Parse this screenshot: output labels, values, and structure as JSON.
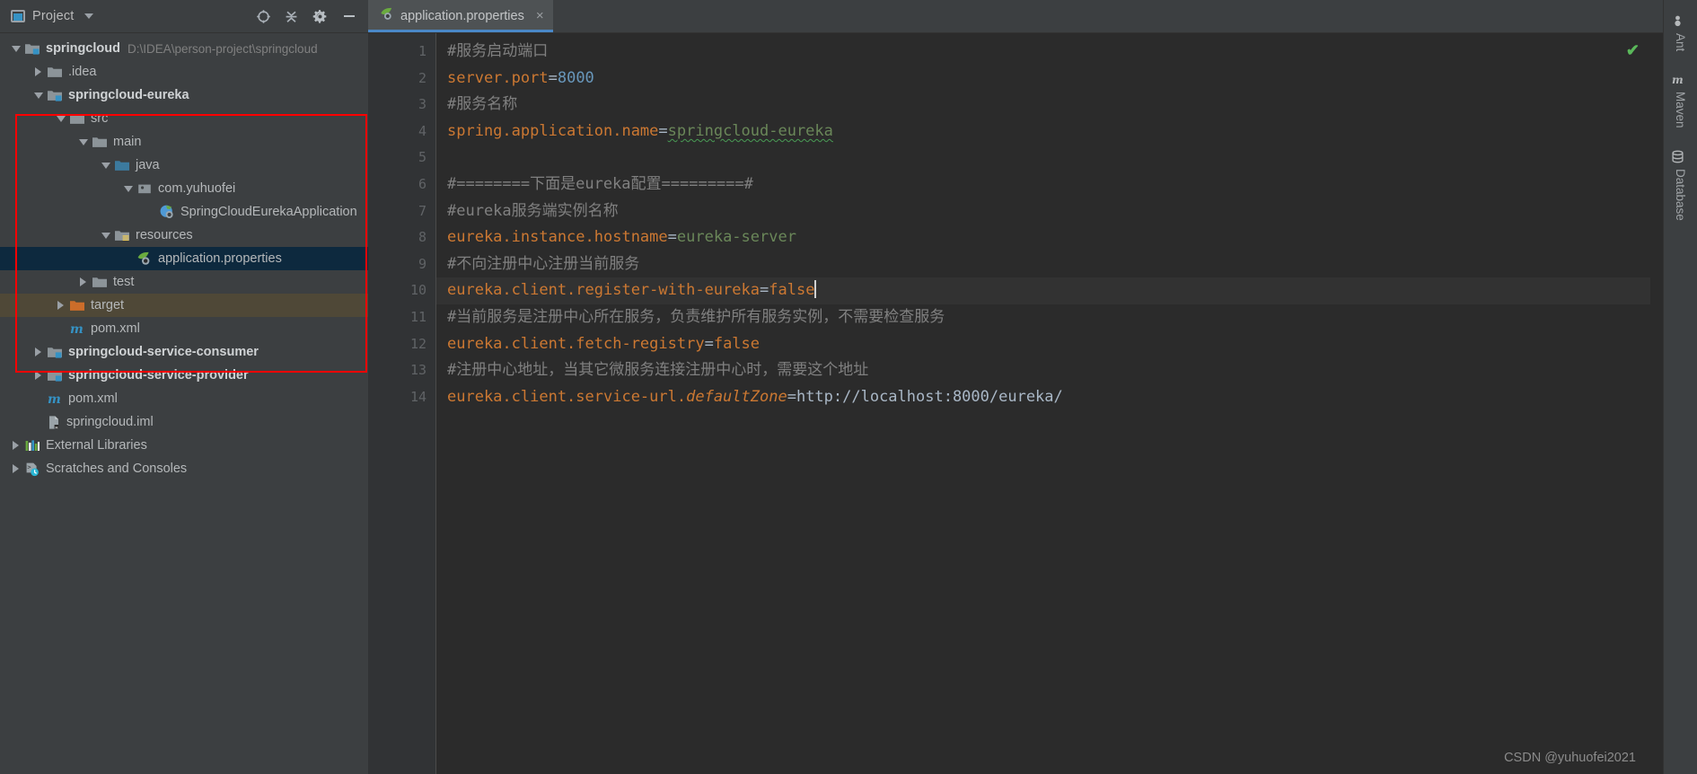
{
  "project_panel": {
    "title": "Project",
    "title_icon": "project-window-icon",
    "actions": [
      {
        "name": "locate-in-tree-icon",
        "glyph": "target-crosshair"
      },
      {
        "name": "collapse-all-icon",
        "glyph": "collapse-arrows"
      },
      {
        "name": "settings-gear-icon",
        "glyph": "gear"
      },
      {
        "name": "hide-panel-icon",
        "glyph": "minus"
      }
    ],
    "tree": [
      {
        "label": "springcloud",
        "path_hint": "D:\\IDEA\\person-project\\springcloud",
        "icon": "module-folder-icon",
        "indent": 0,
        "twisty": "open",
        "bold": true,
        "state": "normal"
      },
      {
        "label": ".idea",
        "path_hint": "",
        "icon": "folder-icon",
        "indent": 1,
        "twisty": "closed",
        "bold": false,
        "state": "normal"
      },
      {
        "label": "springcloud-eureka",
        "path_hint": "",
        "icon": "module-folder-icon",
        "indent": 1,
        "twisty": "open",
        "bold": true,
        "state": "normal"
      },
      {
        "label": "src",
        "path_hint": "",
        "icon": "folder-icon",
        "indent": 2,
        "twisty": "open",
        "bold": false,
        "state": "normal"
      },
      {
        "label": "main",
        "path_hint": "",
        "icon": "folder-icon",
        "indent": 3,
        "twisty": "open",
        "bold": false,
        "state": "normal"
      },
      {
        "label": "java",
        "path_hint": "",
        "icon": "source-root-folder-icon",
        "indent": 4,
        "twisty": "open",
        "bold": false,
        "state": "normal"
      },
      {
        "label": "com.yuhuofei",
        "path_hint": "",
        "icon": "package-icon",
        "indent": 5,
        "twisty": "open",
        "bold": false,
        "state": "normal"
      },
      {
        "label": "SpringCloudEurekaApplication",
        "path_hint": "",
        "icon": "spring-boot-class-icon",
        "indent": 6,
        "twisty": "none",
        "bold": false,
        "state": "normal"
      },
      {
        "label": "resources",
        "path_hint": "",
        "icon": "resources-root-folder-icon",
        "indent": 4,
        "twisty": "open",
        "bold": false,
        "state": "normal"
      },
      {
        "label": "application.properties",
        "path_hint": "",
        "icon": "spring-properties-icon",
        "indent": 5,
        "twisty": "none",
        "bold": false,
        "state": "selected"
      },
      {
        "label": "test",
        "path_hint": "",
        "icon": "folder-icon",
        "indent": 3,
        "twisty": "closed",
        "bold": false,
        "state": "normal"
      },
      {
        "label": "target",
        "path_hint": "",
        "icon": "excluded-folder-icon",
        "indent": 2,
        "twisty": "closed",
        "bold": false,
        "state": "excluded"
      },
      {
        "label": "pom.xml",
        "path_hint": "",
        "icon": "maven-pom-icon",
        "indent": 2,
        "twisty": "none",
        "bold": false,
        "state": "normal"
      },
      {
        "label": "springcloud-service-consumer",
        "path_hint": "",
        "icon": "module-folder-icon",
        "indent": 1,
        "twisty": "closed",
        "bold": true,
        "state": "normal"
      },
      {
        "label": "springcloud-service-provider",
        "path_hint": "",
        "icon": "module-folder-icon",
        "indent": 1,
        "twisty": "closed",
        "bold": true,
        "state": "normal"
      },
      {
        "label": "pom.xml",
        "path_hint": "",
        "icon": "maven-pom-icon",
        "indent": 1,
        "twisty": "none",
        "bold": false,
        "state": "normal"
      },
      {
        "label": "springcloud.iml",
        "path_hint": "",
        "icon": "iml-module-file-icon",
        "indent": 1,
        "twisty": "none",
        "bold": false,
        "state": "normal"
      },
      {
        "label": "External Libraries",
        "path_hint": "",
        "icon": "external-libraries-icon",
        "indent": 0,
        "twisty": "closed",
        "bold": false,
        "state": "normal"
      },
      {
        "label": "Scratches and Consoles",
        "path_hint": "",
        "icon": "scratches-consoles-icon",
        "indent": 0,
        "twisty": "closed",
        "bold": false,
        "state": "normal"
      }
    ],
    "annotation": {
      "name": "red-highlight-rectangle",
      "color": "#fe0000"
    }
  },
  "editor": {
    "tab": {
      "label": "application.properties",
      "icon": "spring-properties-icon",
      "close_glyph": "×",
      "active_underline_color": "#4a88c7"
    },
    "inspection_status": {
      "glyph": "✔",
      "color": "#5ab85a",
      "name": "inspections-ok-icon"
    },
    "caret_line": 10,
    "line_numbers": [
      "1",
      "2",
      "3",
      "4",
      "5",
      "6",
      "7",
      "8",
      "9",
      "10",
      "11",
      "12",
      "13",
      "14"
    ],
    "lines": [
      {
        "n": 1,
        "type": "comment",
        "text": "#服务启动端口"
      },
      {
        "n": 2,
        "type": "prop-num",
        "key": "server.port",
        "value": "8000"
      },
      {
        "n": 3,
        "type": "comment",
        "text": "#服务名称"
      },
      {
        "n": 4,
        "type": "prop-green-squiggle",
        "key": "spring.application.name",
        "value": "springcloud-eureka"
      },
      {
        "n": 5,
        "type": "blank",
        "text": ""
      },
      {
        "n": 6,
        "type": "comment",
        "text": "#========下面是eureka配置=========#"
      },
      {
        "n": 7,
        "type": "comment",
        "text": "#eureka服务端实例名称"
      },
      {
        "n": 8,
        "type": "prop-green",
        "key": "eureka.instance.hostname",
        "value": "eureka-server"
      },
      {
        "n": 9,
        "type": "comment",
        "text": "#不向注册中心注册当前服务"
      },
      {
        "n": 10,
        "type": "prop-orange-caret",
        "key": "eureka.client.register-with-eureka",
        "value": "false"
      },
      {
        "n": 11,
        "type": "comment",
        "text": "#当前服务是注册中心所在服务，负责维护所有服务实例，不需要检查服务"
      },
      {
        "n": 12,
        "type": "prop-orange",
        "key": "eureka.client.fetch-registry",
        "value": "false"
      },
      {
        "n": 13,
        "type": "comment",
        "text": "#注册中心地址，当其它微服务连接注册中心时，需要这个地址"
      },
      {
        "n": 14,
        "type": "prop-url",
        "key": "eureka.client.service-url.",
        "key_italic": "defaultZone",
        "value": "http://localhost:8000/eureka/"
      }
    ],
    "watermark": "CSDN @yuhuofei2021"
  },
  "right_toolbar": {
    "tabs": [
      {
        "label": "Ant",
        "icon": "ant-build-icon",
        "name": "tool-tab-ant"
      },
      {
        "label": "Maven",
        "icon": "maven-icon",
        "name": "tool-tab-maven"
      },
      {
        "label": "Database",
        "icon": "database-icon",
        "name": "tool-tab-database"
      }
    ]
  },
  "colors": {
    "panel_bg": "#3c3f41",
    "editor_bg": "#2b2b2b",
    "gutter_bg": "#313335",
    "selection": "#0d293e",
    "excluded_row": "#4f4837",
    "caret_line": "#323232",
    "comment": "#808080",
    "key_orange": "#cc7832",
    "value_green": "#6a8759",
    "value_number": "#6897bb",
    "accent_blue": "#4a88c7",
    "annotation_red": "#fe0000"
  }
}
